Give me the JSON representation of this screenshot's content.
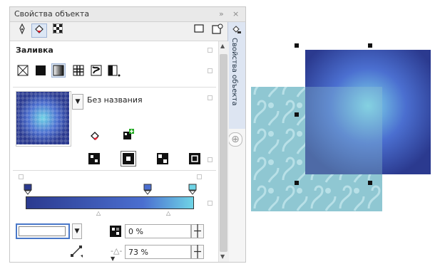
{
  "panel": {
    "title": "Свойства объекта",
    "section_title": "Заливка",
    "fill_name": "Без названия",
    "side_tab_label": "Свойства объекта",
    "transparency_value": "0 %",
    "midpoint_value": "73 %",
    "title_buttons": {
      "pin": "»",
      "close": "×"
    }
  },
  "colors": {
    "gradient_start": "#2b3a8f",
    "gradient_mid": "#4b6fd0",
    "gradient_end": "#6fd4e6",
    "pattern_bg": "#8fc7d2",
    "accent": "#dce7f5"
  }
}
